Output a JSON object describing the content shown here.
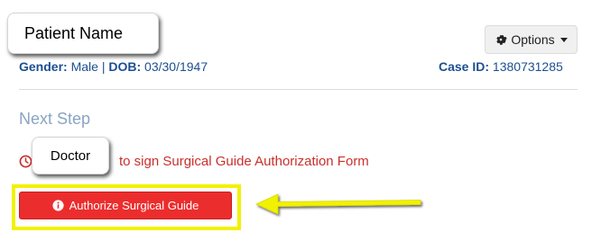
{
  "patient": {
    "name": "Patient Name",
    "gender_label": "Gender:",
    "gender": "Male",
    "separator": "|",
    "dob_label": "DOB:",
    "dob": "03/30/1947"
  },
  "case": {
    "label": "Case ID:",
    "id": "1380731285"
  },
  "toolbar": {
    "options_label": "Options",
    "options_icon": "gear-icon"
  },
  "next_step": {
    "heading": "Next Step",
    "task_text": "to sign Surgical Guide Authorization Form",
    "assignee_callout": "Doctor",
    "task_icon": "clock-icon"
  },
  "action": {
    "authorize_label": "Authorize Surgical Guide",
    "authorize_icon": "info-icon"
  },
  "colors": {
    "accent_blue": "#1d4f91",
    "muted_heading": "#8aa4c4",
    "alert_red": "#c9302c",
    "button_red": "#ec2d2d",
    "highlight_yellow": "#f1f100"
  }
}
